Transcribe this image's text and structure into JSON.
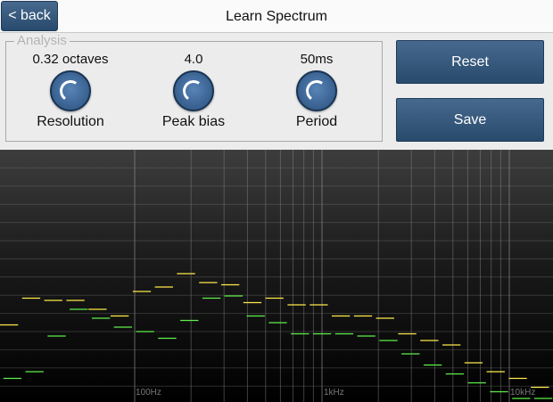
{
  "header": {
    "back_label": "< back",
    "title": "Learn Spectrum"
  },
  "analysis": {
    "legend": "Analysis",
    "knobs": [
      {
        "value": "0.32 octaves",
        "label": "Resolution",
        "icon": "knob-icon"
      },
      {
        "value": "4.0",
        "label": "Peak bias",
        "icon": "knob-icon"
      },
      {
        "value": "50ms",
        "label": "Period",
        "icon": "knob-icon"
      }
    ]
  },
  "buttons": {
    "reset_label": "Reset",
    "save_label": "Save"
  },
  "spectrum": {
    "freq_labels": [
      "100Hz",
      "1kHz",
      "10kHz"
    ],
    "colors": {
      "yellow": "#ffe94a",
      "green": "#5ef04a",
      "grid": "#8a8a8a"
    },
    "yellow_levels": [
      0.33,
      0.45,
      0.44,
      0.44,
      0.4,
      0.37,
      0.48,
      0.5,
      0.56,
      0.52,
      0.51,
      0.43,
      0.45,
      0.42,
      0.42,
      0.37,
      0.37,
      0.36,
      0.29,
      0.26,
      0.24,
      0.16,
      0.12,
      0.09,
      0.05
    ],
    "green_levels": [
      0.09,
      0.12,
      0.28,
      0.4,
      0.36,
      0.32,
      0.3,
      0.27,
      0.35,
      0.45,
      0.46,
      0.37,
      0.34,
      0.29,
      0.29,
      0.29,
      0.28,
      0.26,
      0.2,
      0.15,
      0.11,
      0.07,
      0.03,
      0.0,
      0.0
    ]
  }
}
